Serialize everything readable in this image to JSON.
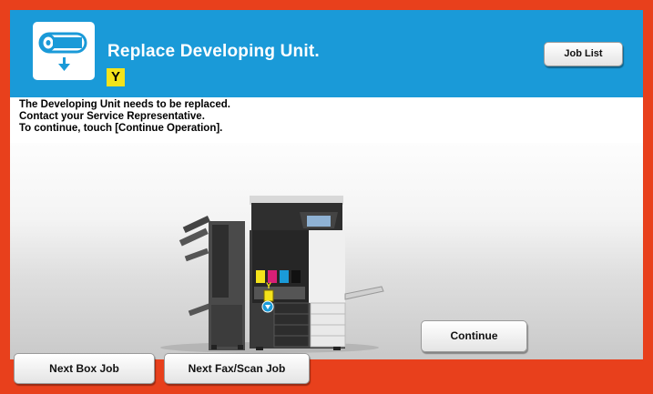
{
  "header": {
    "title": "Replace Developing Unit.",
    "color_badge": "Y",
    "job_list_label": "Job List",
    "icon": "developing-unit-replace-icon"
  },
  "message": {
    "lines": [
      "The Developing Unit needs to be replaced.",
      "Contact your Service Representative.",
      "To continue, touch [Continue Operation]."
    ]
  },
  "illustration": {
    "marker_label": "Y",
    "icon": "printer-illustration"
  },
  "actions": {
    "continue_label": "Continue",
    "next_box_job_label": "Next Box Job",
    "next_fax_scan_job_label": "Next Fax/Scan Job"
  },
  "colors": {
    "frame": "#e8401c",
    "header": "#1a9ad8",
    "badge_yellow": "#f4e31b"
  }
}
